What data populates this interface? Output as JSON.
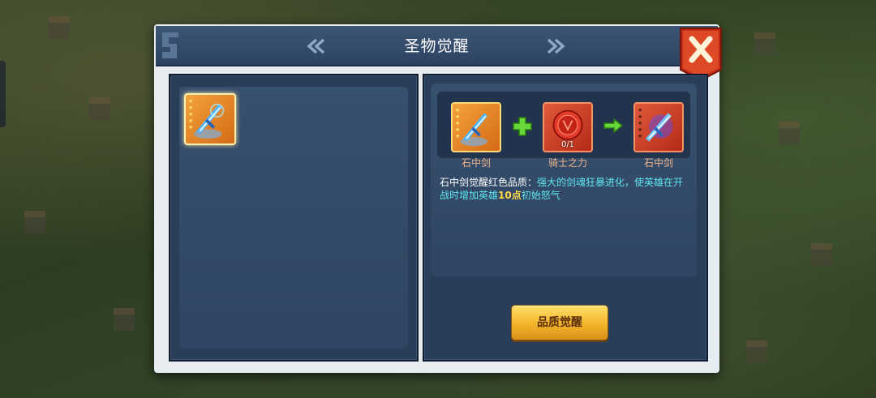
{
  "dialog": {
    "title": "圣物觉醒",
    "prev_arrow_icon": "double-chevron-left-icon",
    "next_arrow_icon": "double-chevron-right-icon",
    "close_icon": "close-x-icon"
  },
  "inventory": {
    "items": [
      {
        "name_icon": "stone-sword-icon",
        "stars": 5,
        "quality": "orange",
        "selected": true
      }
    ]
  },
  "recipe": {
    "source": {
      "label": "石中剑",
      "icon": "stone-sword-icon",
      "stars": 5,
      "quality": "orange"
    },
    "plus_icon": "plus-icon",
    "material": {
      "label": "骑士之力",
      "count": "0/1",
      "icon": "knight-power-coin-icon",
      "quality": "red"
    },
    "arrow_icon": "arrow-right-icon",
    "result": {
      "label": "石中剑",
      "icon": "stone-sword-icon",
      "stars": 5,
      "quality": "red"
    }
  },
  "description": {
    "part1": "石中剑觉醒红色品质：",
    "part2": "强大的剑魂狂暴进化，使英雄在开战时增加英雄",
    "highlight": "10点",
    "part3": "初始怒气"
  },
  "actions": {
    "awaken_label": "品质觉醒"
  },
  "colors": {
    "titlebar": "#2d4261",
    "panel": "#2a3e5a",
    "orange_quality": "#f4a23c",
    "red_quality": "#d13e22",
    "button_gold": "#f3b42a",
    "close_red": "#d33a1f",
    "desc_cyan": "#5ee5ef",
    "desc_yellow": "#ffd84a"
  }
}
